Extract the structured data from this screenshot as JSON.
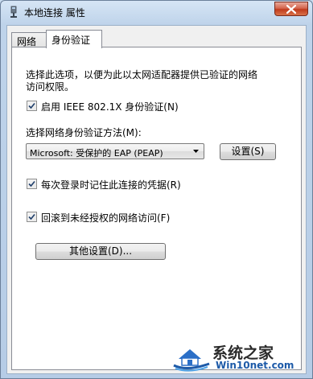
{
  "window": {
    "title": "本地连接 属性"
  },
  "tabs": [
    {
      "label": "网络",
      "active": false
    },
    {
      "label": "身份验证",
      "active": true
    }
  ],
  "auth": {
    "description_line1": "选择此选项，以便为此以太网适配器提供已验证的网络",
    "description_line2": "访问权限。",
    "enable_checkbox": {
      "label": "启用 IEEE 802.1X 身份验证(N)",
      "checked": true
    },
    "method_label": "选择网络身份验证方法(M):",
    "method_dropdown": {
      "selected": "Microsoft: 受保护的 EAP (PEAP)"
    },
    "settings_button": "设置(S)",
    "remember_checkbox": {
      "label": "每次登录时记住此连接的凭据(R)",
      "checked": true
    },
    "fallback_checkbox": {
      "label": "回滚到未经授权的网络访问(F)",
      "checked": true
    },
    "additional_settings_button": "其他设置(D)..."
  },
  "watermark": {
    "line1": "系统之家",
    "line2": "Win10net.com"
  },
  "colors": {
    "titlebar": "#bed3ea",
    "close_button": "#c03a1c",
    "panel_background": "#ffffff",
    "watermark_blue": "#1d5aa8"
  },
  "icons": {
    "title_icon": "network-adapter-icon",
    "close_icon": "close-icon",
    "dropdown_icon": "chevron-down-icon",
    "check_icon": "check-icon",
    "watermark_logo": "house-logo-icon"
  }
}
